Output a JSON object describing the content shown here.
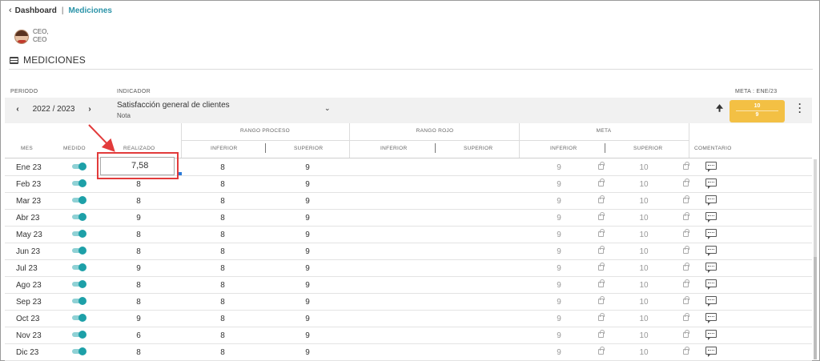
{
  "breadcrumb": {
    "back_icon": "‹",
    "home": "Dashboard",
    "separator": "|",
    "current": "Mediciones"
  },
  "user": {
    "line1": "CEO,",
    "line2": "CEO"
  },
  "section_title": "MEDICIONES",
  "filters": {
    "periodo_label": "PERIODO",
    "period_value": "2022 / 2023",
    "prev_icon": "‹",
    "next_icon": "›",
    "indicador_label": "INDICADOR",
    "indicator_name": "Satisfacción general de clientes",
    "indicator_type": "Nota",
    "meta_label": "META : ENE/23",
    "meta_top": "10",
    "meta_bottom": "9",
    "meta_color": "#f3c044"
  },
  "table": {
    "group_headers": {
      "rango_proceso": "RANGO PROCESO",
      "rango_rojo": "RANGO ROJO",
      "meta": "META"
    },
    "columns": {
      "mes": "MES",
      "medido": "MEDIDO",
      "realizado": "REALIZADO",
      "rp_inferior": "INFERIOR",
      "rp_superior": "SUPERIOR",
      "rr_inferior": "INFERIOR",
      "rr_superior": "SUPERIOR",
      "m_inferior": "INFERIOR",
      "m_superior": "SUPERIOR",
      "comentario": "COMENTARIO"
    },
    "rows": [
      {
        "mes": "Ene 23",
        "realizado": "7,58",
        "rp_inf": "8",
        "rp_sup": "9",
        "m_inf": "9",
        "m_sup": "10"
      },
      {
        "mes": "Feb 23",
        "realizado": "8",
        "rp_inf": "8",
        "rp_sup": "9",
        "m_inf": "9",
        "m_sup": "10"
      },
      {
        "mes": "Mar 23",
        "realizado": "8",
        "rp_inf": "8",
        "rp_sup": "9",
        "m_inf": "9",
        "m_sup": "10"
      },
      {
        "mes": "Abr 23",
        "realizado": "9",
        "rp_inf": "8",
        "rp_sup": "9",
        "m_inf": "9",
        "m_sup": "10"
      },
      {
        "mes": "May 23",
        "realizado": "8",
        "rp_inf": "8",
        "rp_sup": "9",
        "m_inf": "9",
        "m_sup": "10"
      },
      {
        "mes": "Jun 23",
        "realizado": "8",
        "rp_inf": "8",
        "rp_sup": "9",
        "m_inf": "9",
        "m_sup": "10"
      },
      {
        "mes": "Jul 23",
        "realizado": "9",
        "rp_inf": "8",
        "rp_sup": "9",
        "m_inf": "9",
        "m_sup": "10"
      },
      {
        "mes": "Ago 23",
        "realizado": "8",
        "rp_inf": "8",
        "rp_sup": "9",
        "m_inf": "9",
        "m_sup": "10"
      },
      {
        "mes": "Sep 23",
        "realizado": "8",
        "rp_inf": "8",
        "rp_sup": "9",
        "m_inf": "9",
        "m_sup": "10"
      },
      {
        "mes": "Oct 23",
        "realizado": "9",
        "rp_inf": "8",
        "rp_sup": "9",
        "m_inf": "9",
        "m_sup": "10"
      },
      {
        "mes": "Nov 23",
        "realizado": "6",
        "rp_inf": "8",
        "rp_sup": "9",
        "m_inf": "9",
        "m_sup": "10"
      },
      {
        "mes": "Dic 23",
        "realizado": "8",
        "rp_inf": "8",
        "rp_sup": "9",
        "m_inf": "9",
        "m_sup": "10"
      }
    ]
  },
  "colors": {
    "accent": "#2a93a8",
    "toggle": "#1da0a8",
    "annotation": "#e23b3b"
  }
}
